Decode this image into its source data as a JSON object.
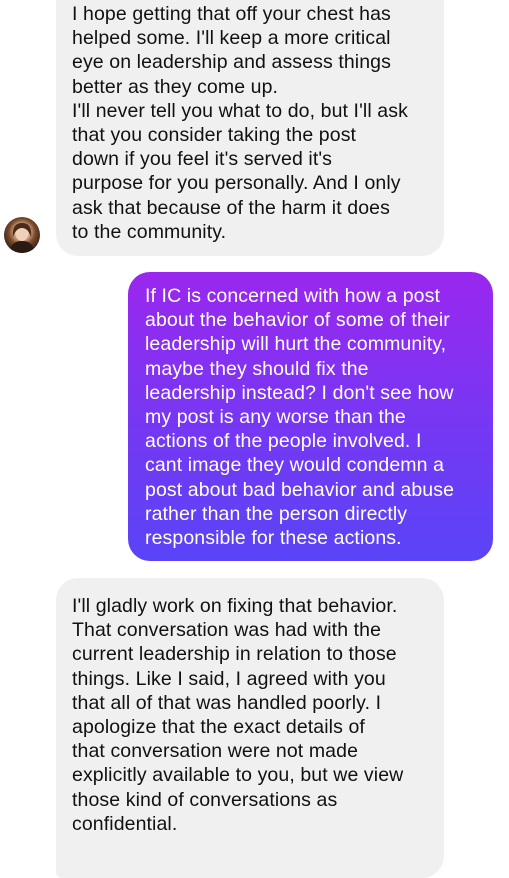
{
  "conversation": {
    "messages": [
      {
        "sender": "other",
        "text": "I hope getting that off your chest has\nhelped some. I'll keep a more critical\neye on leadership and assess things\nbetter as they come up.\nI'll never tell you what to do, but I'll ask\nthat you consider taking the post\ndown if you feel it's served it's\npurpose for you personally. And I only\nask that because of the harm it does\nto the community."
      },
      {
        "sender": "me",
        "text": "If IC is concerned with how a post\nabout the behavior of some of their\nleadership will hurt the community,\nmaybe they should fix the\nleadership instead? I don't see how\nmy post is any worse than the\nactions of the people involved. I\ncant image they would condemn a\npost about bad behavior and abuse\nrather than the person directly\nresponsible for these actions."
      },
      {
        "sender": "other",
        "text": "I'll gladly work on fixing that behavior.\nThat conversation was had with the\ncurrent leadership in relation to those\nthings. Like I said, I agreed with you\nthat all of that was handled poorly. I\napologize that the exact details of\nthat conversation were not made\nexplicitly available to you, but we view\nthose kind of conversations as\nconfidential."
      }
    ]
  },
  "colors": {
    "incoming_bubble": "#f0f0f0",
    "incoming_text": "#111111",
    "outgoing_gradient_top": "#9a27ee",
    "outgoing_gradient_bottom": "#5a44f7",
    "outgoing_text": "#ffffff"
  },
  "avatar_icon": "profile-photo"
}
